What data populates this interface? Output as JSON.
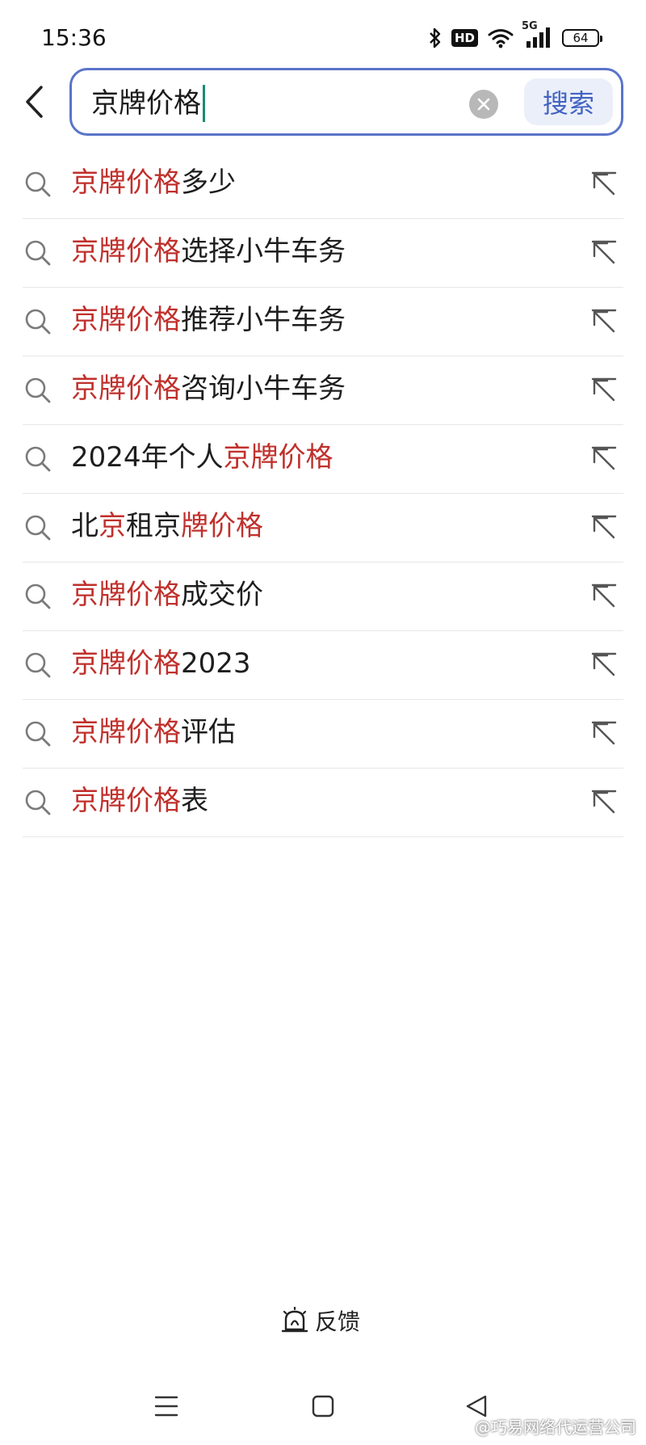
{
  "status_bar": {
    "time": "15:36",
    "hd_label": "HD",
    "network_label": "5G",
    "battery_level": "64"
  },
  "search": {
    "query": "京牌价格",
    "submit_label": "搜索"
  },
  "suggestions": [
    {
      "parts": [
        {
          "text": "京牌价格",
          "hl": true
        },
        {
          "text": "多少",
          "hl": false
        }
      ]
    },
    {
      "parts": [
        {
          "text": "京牌价格",
          "hl": true
        },
        {
          "text": "选择小牛车务",
          "hl": false
        }
      ]
    },
    {
      "parts": [
        {
          "text": "京牌价格",
          "hl": true
        },
        {
          "text": "推荐小牛车务",
          "hl": false
        }
      ]
    },
    {
      "parts": [
        {
          "text": "京牌价格",
          "hl": true
        },
        {
          "text": "咨询小牛车务",
          "hl": false
        }
      ]
    },
    {
      "parts": [
        {
          "text": "2024年个人",
          "hl": false
        },
        {
          "text": "京牌价格",
          "hl": true
        }
      ]
    },
    {
      "parts": [
        {
          "text": "北",
          "hl": false
        },
        {
          "text": "京",
          "hl": true
        },
        {
          "text": "租京",
          "hl": false
        },
        {
          "text": "牌价格",
          "hl": true
        }
      ]
    },
    {
      "parts": [
        {
          "text": "京牌价格",
          "hl": true
        },
        {
          "text": "成交价",
          "hl": false
        }
      ]
    },
    {
      "parts": [
        {
          "text": "京牌价格",
          "hl": true
        },
        {
          "text": "2023",
          "hl": false
        }
      ]
    },
    {
      "parts": [
        {
          "text": "京牌价格",
          "hl": true
        },
        {
          "text": "评估",
          "hl": false
        }
      ]
    },
    {
      "parts": [
        {
          "text": "京牌价格",
          "hl": true
        },
        {
          "text": "表",
          "hl": false
        }
      ]
    }
  ],
  "feedback": {
    "label": "反馈"
  },
  "watermark": "@巧易网络代运营公司",
  "colors": {
    "accent": "#5a74c9",
    "highlight": "#c0302c",
    "search_button_text": "#4263c2",
    "search_button_bg": "#ebeff9"
  },
  "icons": {
    "back": "chevron-left-icon",
    "clear": "clear-icon",
    "suggestion": "search-icon",
    "fill": "arrow-up-left-icon",
    "feedback": "feedback-icon",
    "nav": [
      "menu-icon",
      "home-square-icon",
      "back-triangle-icon"
    ]
  }
}
